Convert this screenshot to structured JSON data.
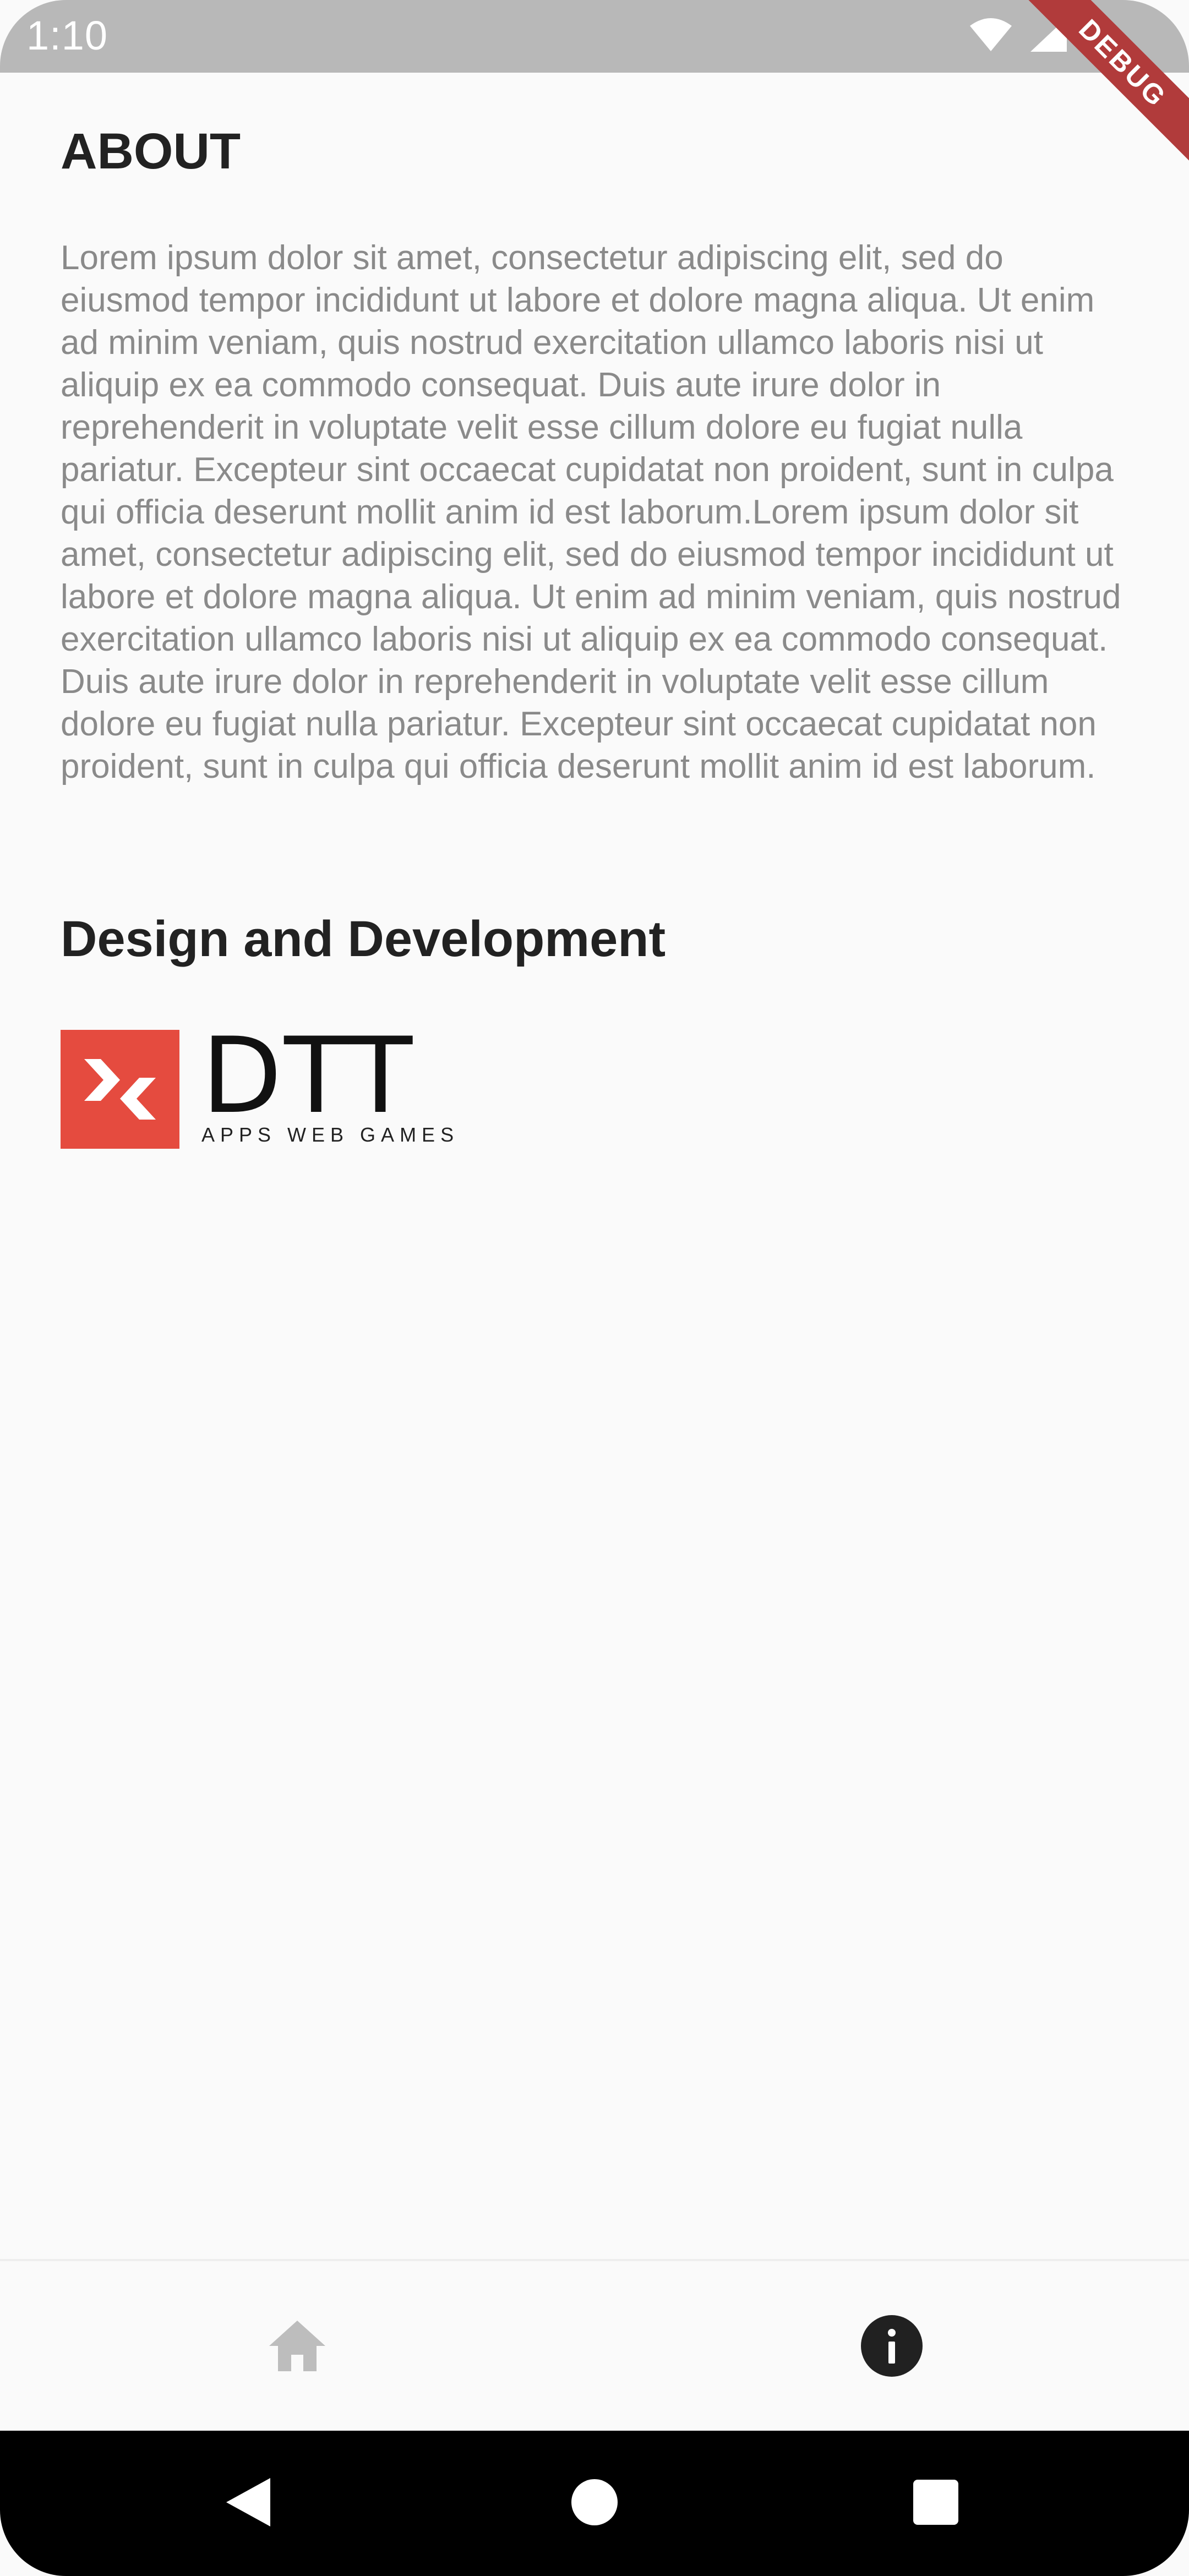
{
  "status_bar": {
    "time": "1:10",
    "icons": [
      "wifi-icon",
      "signal-icon",
      "battery-icon"
    ],
    "debug_label": "DEBUG"
  },
  "about": {
    "title": "ABOUT",
    "body": "Lorem ipsum dolor sit amet, consectetur adipiscing elit, sed do eiusmod tempor incididunt ut labore et dolore magna aliqua. Ut enim ad minim veniam, quis nostrud exercitation ullamco laboris nisi ut aliquip ex ea commodo consequat. Duis aute irure dolor in reprehenderit in voluptate velit esse cillum dolore eu fugiat nulla pariatur. Excepteur sint occaecat cupidatat non proident, sunt in culpa qui officia deserunt mollit anim id est laborum.Lorem ipsum dolor sit amet, consectetur adipiscing elit, sed do eiusmod tempor incididunt ut labore et dolore magna aliqua. Ut enim ad minim veniam, quis nostrud exercitation ullamco laboris nisi ut aliquip ex ea commodo consequat. Duis aute irure dolor in reprehenderit in voluptate velit esse cillum dolore eu fugiat nulla pariatur. Excepteur sint occaecat cupidatat non proident, sunt in culpa qui officia deserunt mollit anim id est laborum."
  },
  "credits": {
    "title": "Design and Development",
    "logo": {
      "name": "DTT",
      "tagline": "APPS WEB GAMES",
      "color": "#e54b3f"
    }
  },
  "bottom_nav": {
    "items": [
      {
        "icon": "home-icon",
        "active": false,
        "color": "#bdbdbd"
      },
      {
        "icon": "info-icon",
        "active": true,
        "color": "#212121"
      }
    ]
  },
  "system_nav": {
    "buttons": [
      "back-icon",
      "home-circle-icon",
      "recents-icon"
    ]
  }
}
